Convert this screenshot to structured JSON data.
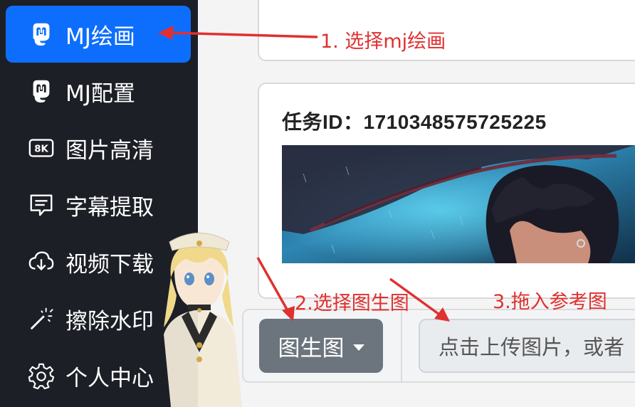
{
  "sidebar": {
    "items": [
      {
        "label": "MJ绘画",
        "icon": "mastodon-icon",
        "active": true
      },
      {
        "label": "MJ配置",
        "icon": "mastodon-icon",
        "active": false
      },
      {
        "label": "图片高清",
        "icon": "8k-icon",
        "active": false
      },
      {
        "label": "字幕提取",
        "icon": "message-text-icon",
        "active": false
      },
      {
        "label": "视频下载",
        "icon": "cloud-download-icon",
        "active": false
      },
      {
        "label": "擦除水印",
        "icon": "magic-wand-icon",
        "active": false
      },
      {
        "label": "个人中心",
        "icon": "gear-icon",
        "active": false
      }
    ]
  },
  "main": {
    "task_title": "任务ID：1710348575725225",
    "toolbar": {
      "mode_label": "图生图",
      "upload_placeholder": "点击上传图片，或者"
    }
  },
  "annotations": {
    "step1": "1. 选择mj绘画",
    "step2": "2.选择图生图",
    "step3": "3.拖入参考图"
  },
  "colors": {
    "sidebar_bg": "#1c1f26",
    "active_item": "#0d6efd",
    "annotation": "#e03030",
    "dropdown_bg": "#6c757d"
  }
}
